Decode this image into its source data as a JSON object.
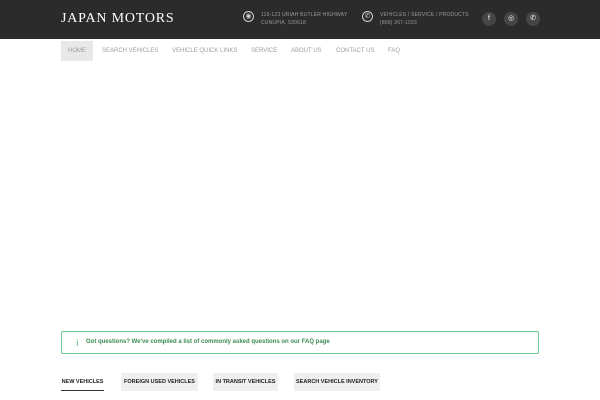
{
  "header": {
    "logo": "JAPAN MOTORS",
    "address": {
      "line1": "115-123 URIAH BUTLER HIGHWAY",
      "line2": "CUNUPIA, 530618",
      "icon": "location-pin-icon"
    },
    "phone": {
      "line1": "VEHICLES / SERVICE / PRODUCTS",
      "line2": "(868) 267-1033",
      "icon": "phone-icon"
    },
    "social": [
      {
        "name": "facebook-icon",
        "glyph": "f"
      },
      {
        "name": "instagram-icon",
        "glyph": "◎"
      },
      {
        "name": "whatsapp-icon",
        "glyph": "✆"
      }
    ]
  },
  "nav": {
    "items": [
      {
        "label": "HOME",
        "active": true
      },
      {
        "label": "SEARCH VEHICLES",
        "active": false
      },
      {
        "label": "VEHICLE QUICK LINKS",
        "active": false
      },
      {
        "label": "SERVICE",
        "active": false
      },
      {
        "label": "ABOUT US",
        "active": false
      },
      {
        "label": "CONTACT US",
        "active": false
      },
      {
        "label": "FAQ",
        "active": false
      }
    ]
  },
  "notice": {
    "text": "Got questions? We've compiled a list of commonly asked questions on our FAQ page",
    "icon": "info-icon",
    "border_color": "#74c98e",
    "text_color": "#3a8a52"
  },
  "tabs": [
    {
      "label": "NEW VEHICLES",
      "active": true
    },
    {
      "label": "FOREIGN USED VEHICLES",
      "active": false
    },
    {
      "label": "IN TRANSIT VEHICLES",
      "active": false
    },
    {
      "label": "SEARCH VEHICLE INVENTORY",
      "active": false
    }
  ]
}
